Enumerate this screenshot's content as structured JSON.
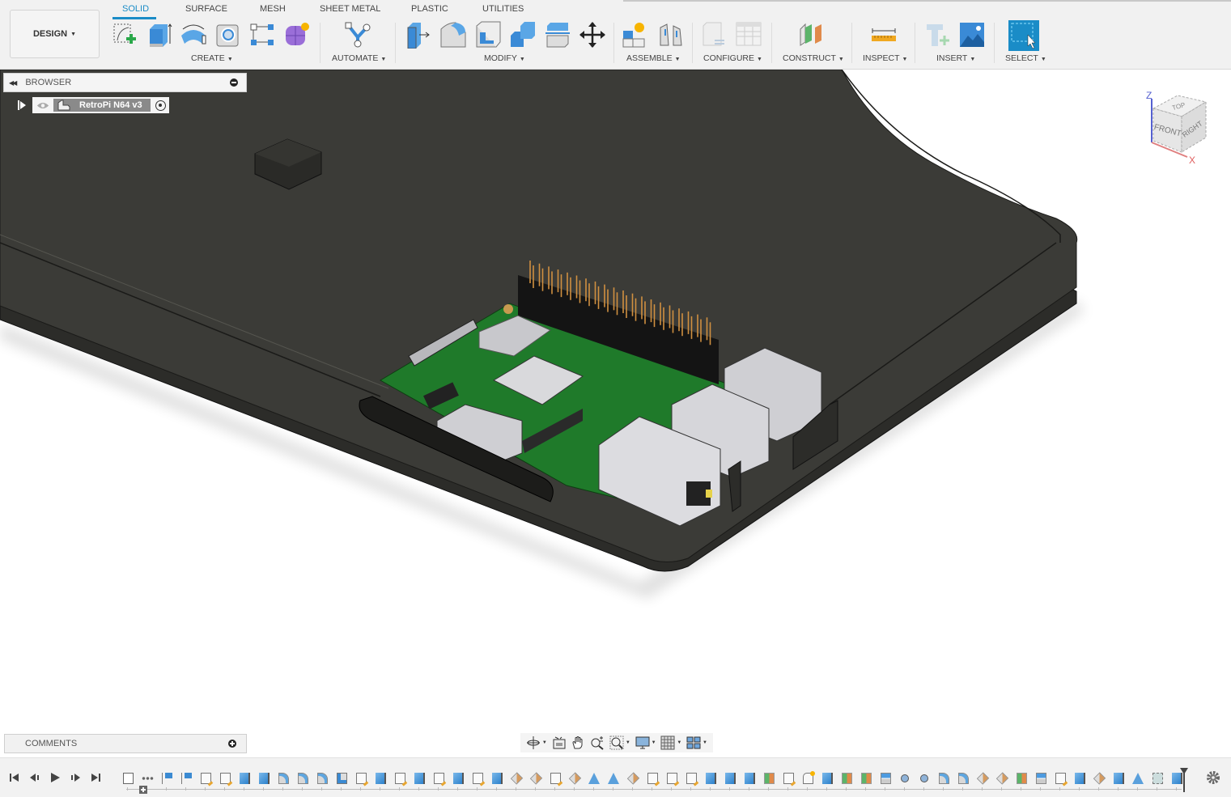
{
  "app": {
    "workspace_button": "DESIGN",
    "tabs": [
      {
        "label": "SOLID",
        "active": true
      },
      {
        "label": "SURFACE",
        "active": false
      },
      {
        "label": "MESH",
        "active": false
      },
      {
        "label": "SHEET METAL",
        "active": false
      },
      {
        "label": "PLASTIC",
        "active": false
      },
      {
        "label": "UTILITIES",
        "active": false
      }
    ],
    "groups": {
      "create": "CREATE",
      "automate": "AUTOMATE",
      "modify": "MODIFY",
      "assemble": "ASSEMBLE",
      "configure": "CONFIGURE",
      "construct": "CONSTRUCT",
      "inspect": "INSPECT",
      "insert": "INSERT",
      "select": "SELECT"
    },
    "tools": {
      "create": [
        "create-sketch",
        "extrude",
        "revolve",
        "hole",
        "pattern",
        "create-form"
      ],
      "automate": [
        "automate"
      ],
      "modify": [
        "press-pull",
        "fillet",
        "shell",
        "combine",
        "split-body",
        "move-copy"
      ],
      "assemble": [
        "new-component",
        "joint"
      ],
      "configure": [
        "configure-design",
        "configuration-table"
      ],
      "construct": [
        "offset-plane"
      ],
      "inspect": [
        "measure"
      ],
      "insert": [
        "insert-mcmaster",
        "insert-canvas"
      ],
      "select": [
        "select-window"
      ]
    },
    "accent_color": "#1a8cc7"
  },
  "browser": {
    "title": "BROWSER",
    "root_item": "RetroPi N64 v3"
  },
  "viewcube": {
    "faces": {
      "top": "TOP",
      "front": "FRONT",
      "right": "RIGHT"
    },
    "axes": {
      "z": "Z",
      "x": "X"
    }
  },
  "comments": {
    "title": "COMMENTS"
  },
  "nav_bar": {
    "items": [
      "orbit",
      "look-at",
      "pan",
      "zoom",
      "fit",
      "display-settings",
      "grid-snaps",
      "viewports"
    ]
  },
  "timeline": {
    "controls": [
      "go-to-start",
      "step-back",
      "play",
      "step-forward",
      "go-to-end"
    ],
    "features": [
      "anchor",
      "grip",
      "flag",
      "flag",
      "sketch",
      "sketch",
      "extrude",
      "extrude",
      "fillet",
      "fillet",
      "fillet",
      "shell",
      "sketch",
      "extrude",
      "sketch",
      "extrude",
      "sketch",
      "extrude",
      "sketch",
      "extrude",
      "chamfer",
      "chamfer",
      "sketch",
      "chamfer",
      "draft",
      "draft",
      "chamfer",
      "sketch",
      "sketch",
      "sketch",
      "extrude",
      "extrude",
      "extrude",
      "plane",
      "sketch",
      "component",
      "extrude",
      "plane",
      "plane",
      "split",
      "joint",
      "joint",
      "fillet",
      "fillet",
      "chamfer",
      "chamfer",
      "plane",
      "split",
      "sketch",
      "extrude",
      "chamfer",
      "extrude",
      "draft",
      "combine",
      "extrude"
    ]
  },
  "model": {
    "case_color": "#3a3a36",
    "pcb_color": "#1f7a2a"
  }
}
